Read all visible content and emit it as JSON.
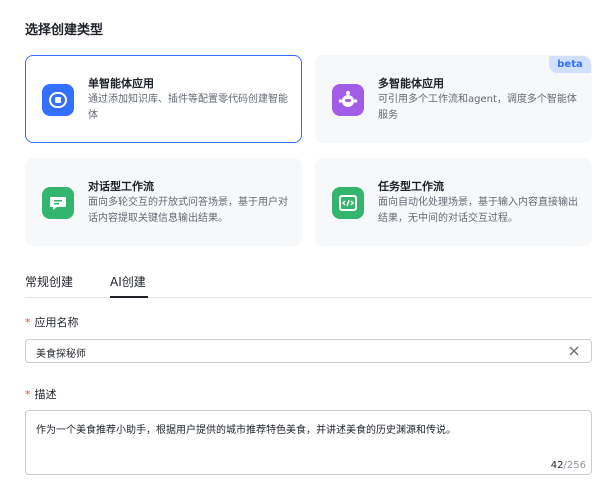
{
  "section_title": "选择创建类型",
  "cards": [
    {
      "title": "单智能体应用",
      "desc": "通过添加知识库、插件等配置零代码创建智能体",
      "icon": "single-agent-icon",
      "color": "#3370ff",
      "selected": true
    },
    {
      "title": "多智能体应用",
      "desc": "可引用多个工作流和agent，调度多个智能体服务",
      "icon": "multi-agent-icon",
      "color": "#a35ce6",
      "badge": "beta"
    },
    {
      "title": "对话型工作流",
      "desc": "面向多轮交互的开放式问答场景，基于用户对话内容提取关键信息输出结果。",
      "icon": "chat-workflow-icon",
      "color": "#34b56e"
    },
    {
      "title": "任务型工作流",
      "desc": "面向自动化处理场景，基于输入内容直接输出结果，无中间的对话交互过程。",
      "icon": "task-workflow-icon",
      "color": "#34b56e"
    }
  ],
  "tabs": [
    {
      "label": "常规创建",
      "active": false
    },
    {
      "label": "AI创建",
      "active": true
    }
  ],
  "form": {
    "name_label": "应用名称",
    "name_value": "美食探秘师",
    "desc_label": "描述",
    "desc_value": "作为一个美食推荐小助手，根据用户提供的城市推荐特色美食，并讲述美食的历史渊源和传说。",
    "counter_current": "42",
    "counter_max": "/256",
    "required_mark": "*"
  }
}
